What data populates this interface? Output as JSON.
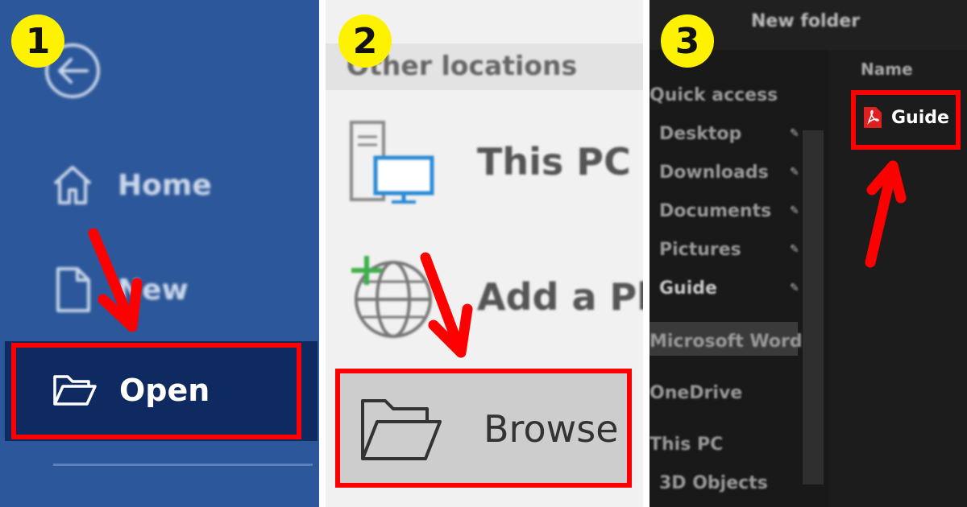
{
  "steps": {
    "step1": "1",
    "step2": "2",
    "step3": "3"
  },
  "panel1": {
    "items": {
      "home": "Home",
      "new": "New",
      "open": "Open"
    },
    "icons": [
      "back-arrow-icon",
      "home-icon",
      "new-document-icon",
      "open-folder-icon"
    ],
    "colors": {
      "background": "#2c579a",
      "selected": "#0f2a60",
      "highlight": "#ff0000"
    }
  },
  "panel2": {
    "header": "Other locations",
    "items": {
      "this_pc": "This PC",
      "add_place": "Add a Pl",
      "browse": "Browse"
    },
    "icons": [
      "pc-icon",
      "add-place-globe-icon",
      "folder-icon"
    ]
  },
  "panel3": {
    "toolbar": "New folder",
    "column_header": "Name",
    "nav": {
      "quick_access": "Quick access",
      "desktop": "Desktop",
      "downloads": "Downloads",
      "documents": "Documents",
      "pictures": "Pictures",
      "guide": "Guide",
      "word": "Microsoft Word",
      "onedrive": "OneDrive",
      "thispc": "This PC",
      "objects3d": "3D Objects"
    },
    "file": {
      "name": "Guide",
      "icon": "pdf-file-icon"
    }
  }
}
